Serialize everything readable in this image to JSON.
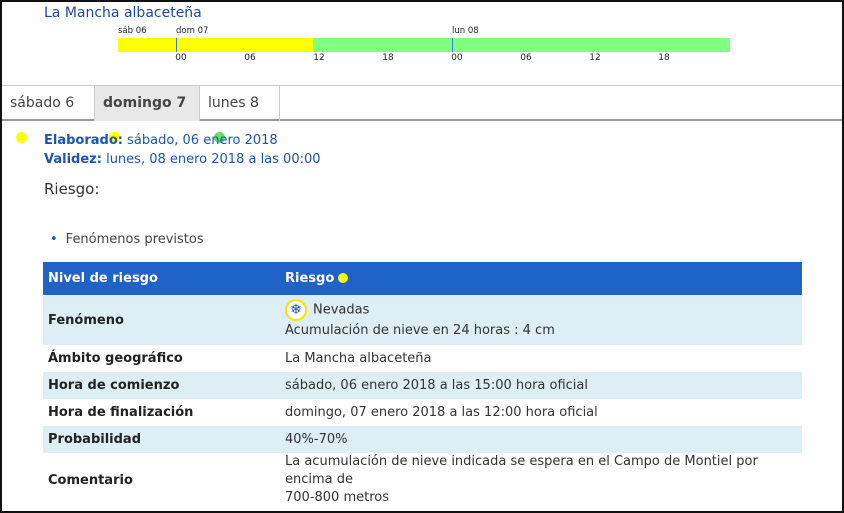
{
  "region": "La Mancha albaceteña",
  "timeline": {
    "day_labels": [
      "sáb 06",
      "dom 07",
      "lun 08"
    ],
    "ticks": [
      "00",
      "06",
      "12",
      "18",
      "00",
      "06",
      "12",
      "18"
    ],
    "colors": {
      "yellow": "#ffff00",
      "green": "#80ff80"
    }
  },
  "tabs": [
    {
      "label": "sábado 6",
      "dot_color": "#ffff00",
      "active": false
    },
    {
      "label": "domingo 7",
      "dot_color": "#ffff00",
      "active": true
    },
    {
      "label": "lunes 8",
      "dot_color": "#66dd66",
      "active": false
    }
  ],
  "meta": {
    "elaborado_label": "Elaborado:",
    "elaborado_value": "sábado, 06 enero 2018",
    "validez_label": "Validez:",
    "validez_value": "lunes, 08 enero 2018 a las 00:00"
  },
  "riesgo_heading": "Riesgo:",
  "bullet": "Fenómenos previstos",
  "table": {
    "header": {
      "col1": "Nivel de riesgo",
      "col2": "Riesgo",
      "dot_color": "#ffff00"
    },
    "fenomeno": {
      "key": "Fenómeno",
      "icon": "snowflake-icon",
      "name": "Nevadas",
      "detail": "Acumulación de nieve en 24 horas : 4 cm"
    },
    "rows": [
      {
        "key": "Ámbito geográfico",
        "value": "La Mancha albaceteña"
      },
      {
        "key": "Hora de comienzo",
        "value": "sábado, 06 enero 2018 a las 15:00 hora oficial"
      },
      {
        "key": "Hora de finalización",
        "value": "domingo, 07 enero 2018 a las 12:00 hora oficial"
      },
      {
        "key": "Probabilidad",
        "value": "40%-70%"
      }
    ],
    "comentario": {
      "key": "Comentario",
      "line1": "La acumulación de nieve indicada se espera en el Campo de Montiel por encima de",
      "line2": "700-800 metros"
    }
  }
}
